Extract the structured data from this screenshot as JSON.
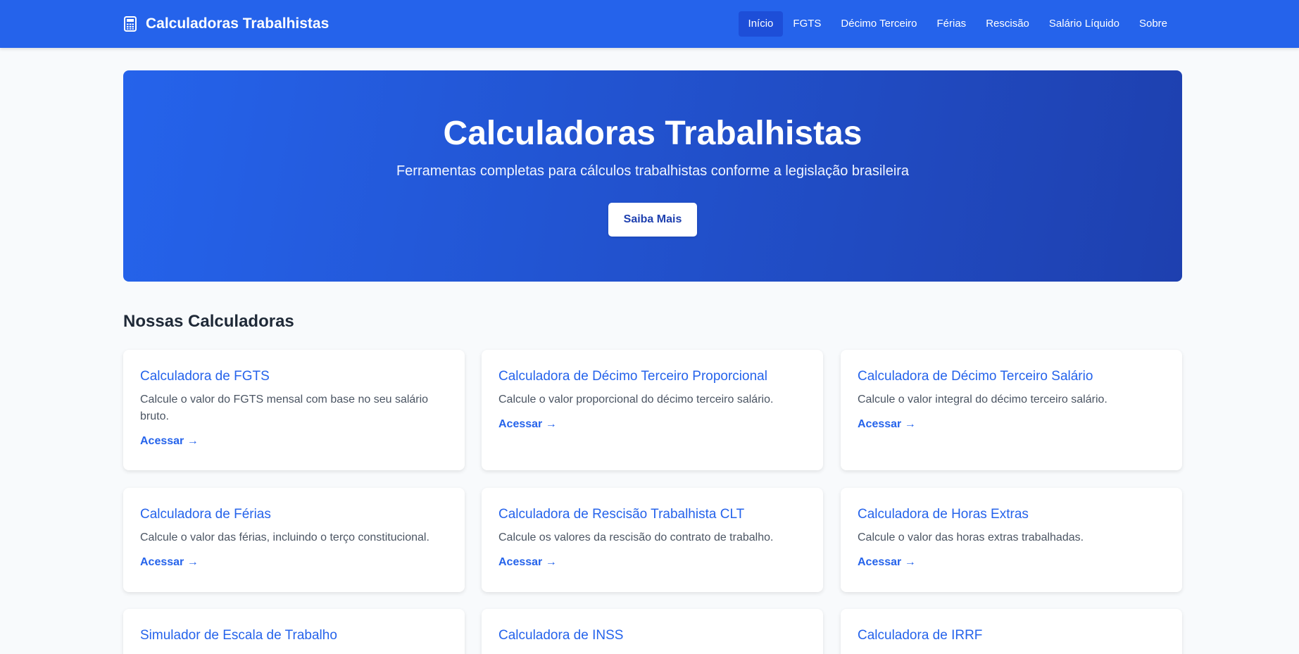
{
  "nav": {
    "brand": "Calculadoras Trabalhistas",
    "brand_icon": "calculator-icon",
    "links": [
      {
        "label": "Início",
        "active": true
      },
      {
        "label": "FGTS",
        "active": false
      },
      {
        "label": "Décimo Terceiro",
        "active": false
      },
      {
        "label": "Férias",
        "active": false
      },
      {
        "label": "Rescisão",
        "active": false
      },
      {
        "label": "Salário Líquido",
        "active": false
      },
      {
        "label": "Sobre",
        "active": false
      }
    ]
  },
  "hero": {
    "title": "Calculadoras Trabalhistas",
    "subtitle": "Ferramentas completas para cálculos trabalhistas conforme a legislação brasileira",
    "button": "Saiba Mais"
  },
  "section": {
    "title": "Nossas Calculadoras"
  },
  "cards": [
    {
      "title": "Calculadora de FGTS",
      "description": "Calcule o valor do FGTS mensal com base no seu salário bruto.",
      "link": "Acessar →"
    },
    {
      "title": "Calculadora de Décimo Terceiro Proporcional",
      "description": "Calcule o valor proporcional do décimo terceiro salário.",
      "link": "Acessar →"
    },
    {
      "title": "Calculadora de Décimo Terceiro Salário",
      "description": "Calcule o valor integral do décimo terceiro salário.",
      "link": "Acessar →"
    },
    {
      "title": "Calculadora de Férias",
      "description": "Calcule o valor das férias, incluindo o terço constitucional.",
      "link": "Acessar →"
    },
    {
      "title": "Calculadora de Rescisão Trabalhista CLT",
      "description": "Calcule os valores da rescisão do contrato de trabalho.",
      "link": "Acessar →"
    },
    {
      "title": "Calculadora de Horas Extras",
      "description": "Calcule o valor das horas extras trabalhadas.",
      "link": "Acessar →"
    },
    {
      "title": "Simulador de Escala de Trabalho",
      "description": "",
      "link": ""
    },
    {
      "title": "Calculadora de INSS",
      "description": "",
      "link": ""
    },
    {
      "title": "Calculadora de IRRF",
      "description": "",
      "link": ""
    }
  ],
  "colors": {
    "primary": "#2563eb",
    "primary_dark": "#1e40af",
    "background": "#f8fafc"
  }
}
